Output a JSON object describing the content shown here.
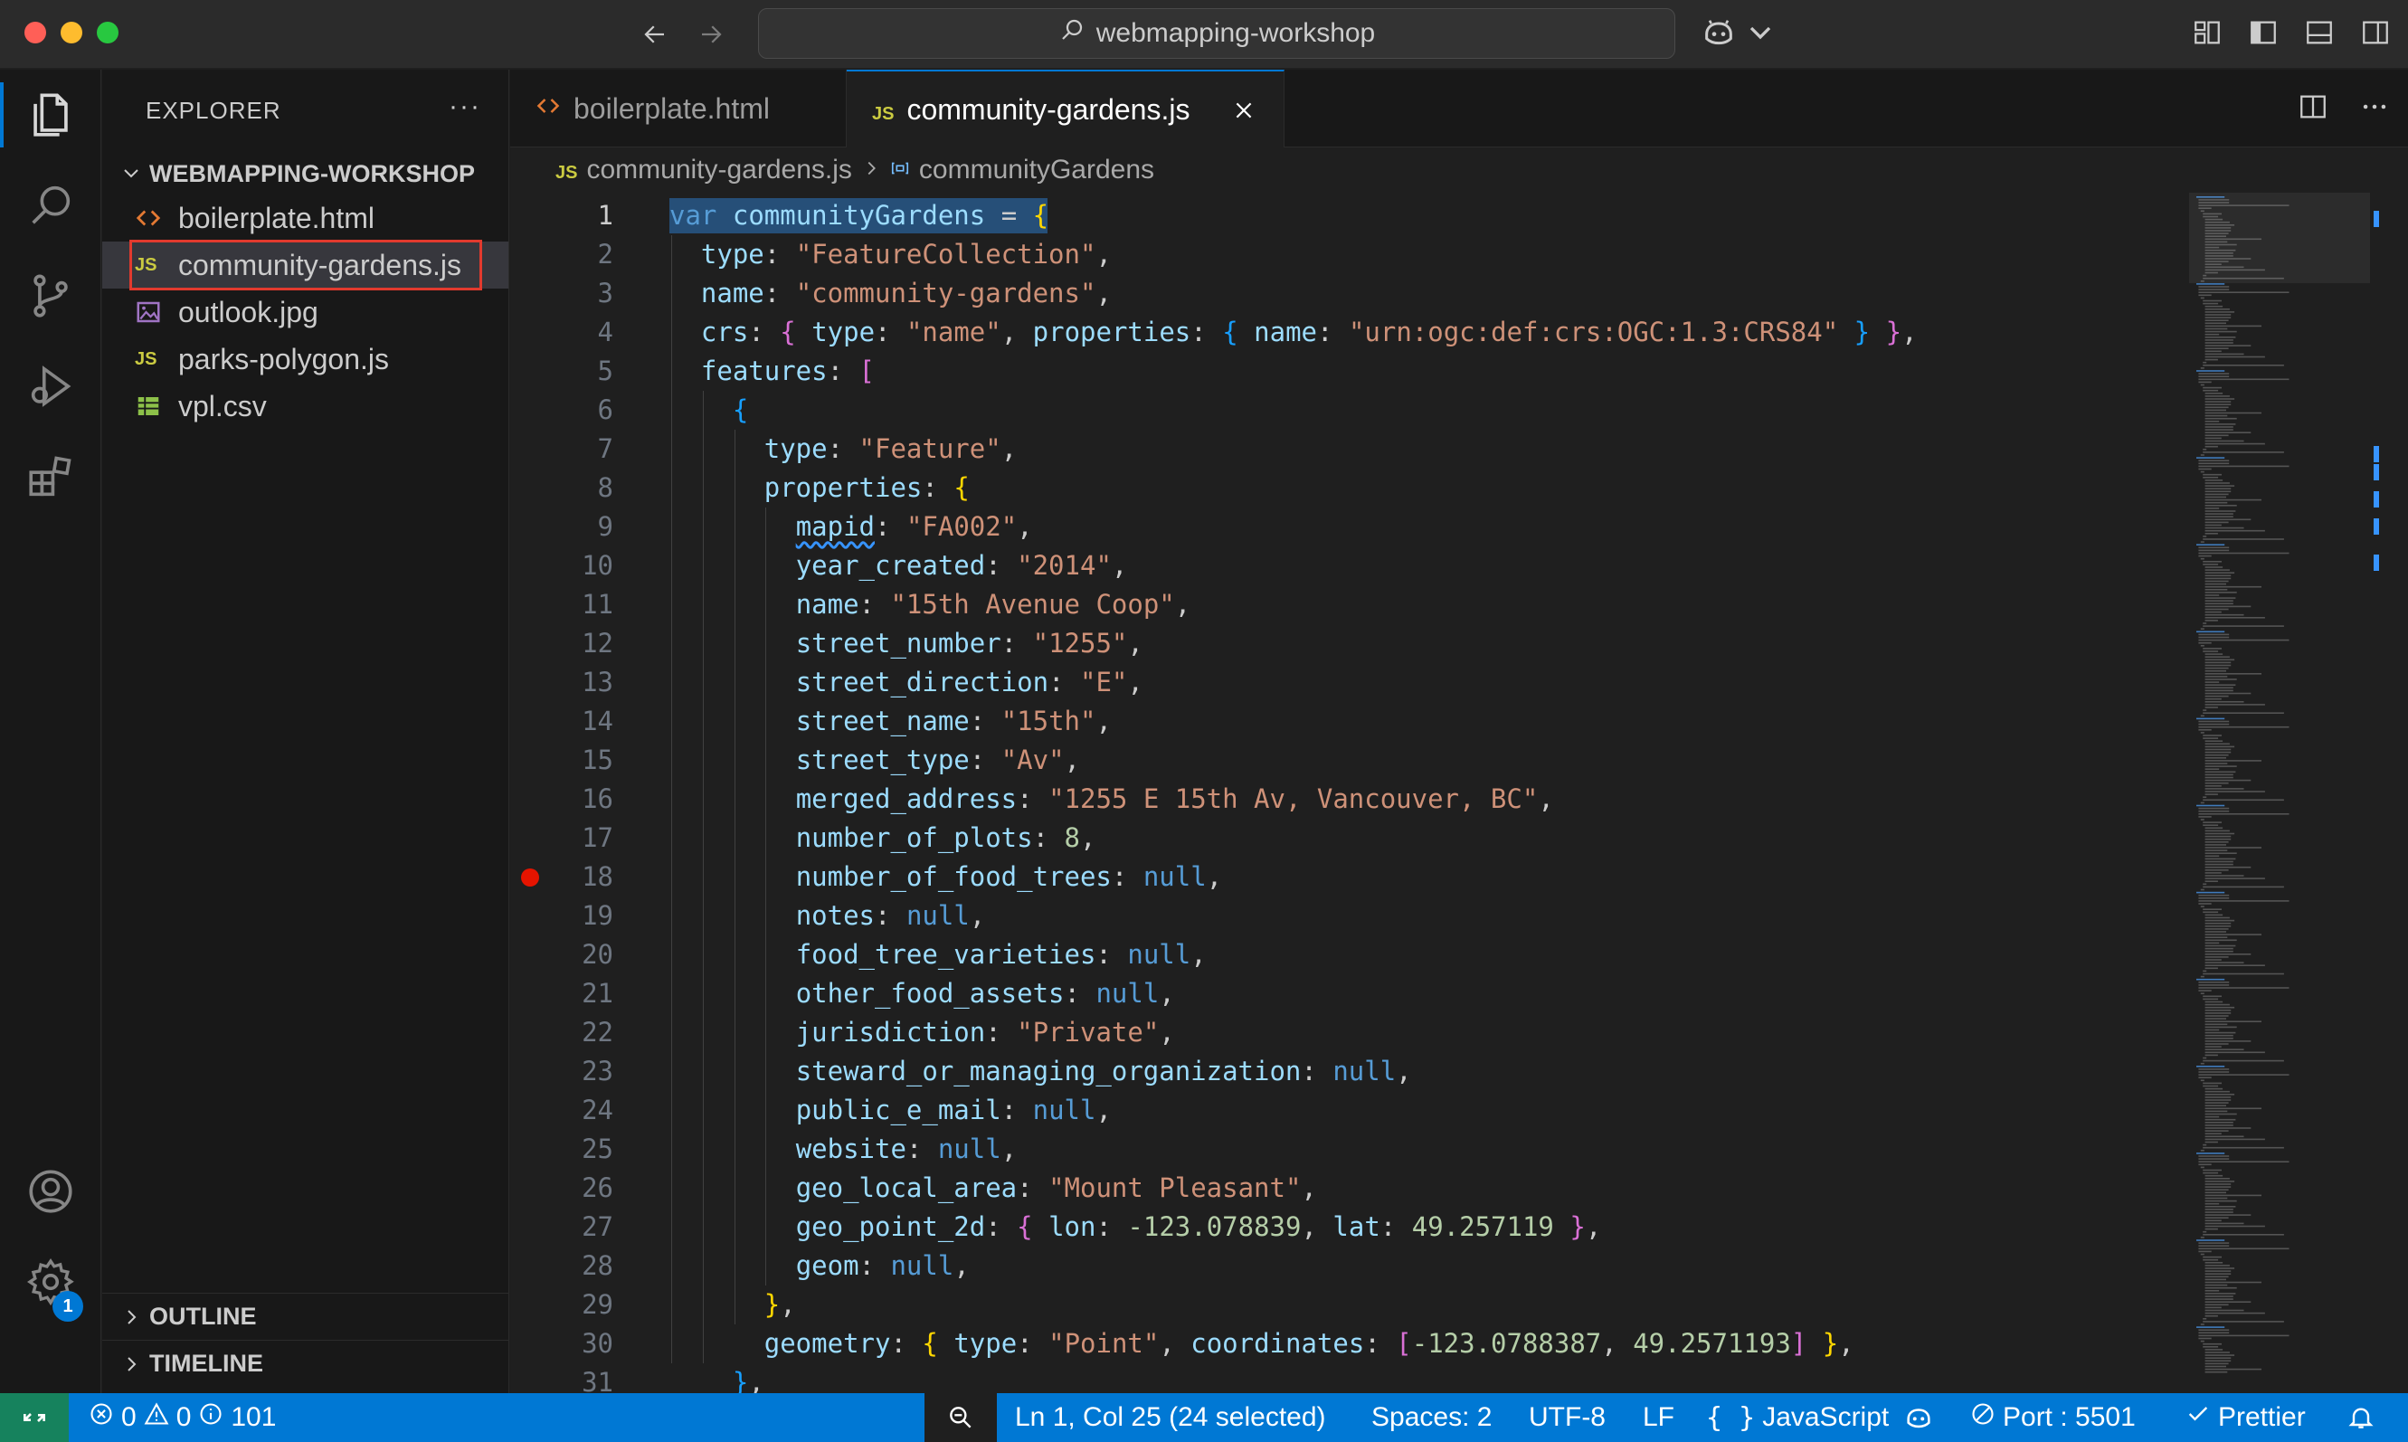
{
  "window": {
    "title": "webmapping-workshop"
  },
  "sidebar": {
    "header": "EXPLORER",
    "more": "···",
    "folder": "WEBMAPPING-WORKSHOP",
    "files": [
      {
        "name": "boilerplate.html",
        "icon": "html-icon"
      },
      {
        "name": "community-gardens.js",
        "icon": "js-icon",
        "selected": true
      },
      {
        "name": "outlook.jpg",
        "icon": "image-icon"
      },
      {
        "name": "parks-polygon.js",
        "icon": "js-icon"
      },
      {
        "name": "vpl.csv",
        "icon": "csv-icon"
      }
    ],
    "js_label": "JS",
    "outline": "OUTLINE",
    "timeline": "TIMELINE"
  },
  "tabs": [
    {
      "label": "boilerplate.html",
      "active": false
    },
    {
      "label": "community-gardens.js",
      "active": true
    }
  ],
  "breadcrumb": {
    "file": "community-gardens.js",
    "symbol": "communityGardens"
  },
  "editor": {
    "breakpoint_line": 18,
    "current_line": 1,
    "lines": [
      "var communityGardens = {",
      "  type: \"FeatureCollection\",",
      "  name: \"community-gardens\",",
      "  crs: { type: \"name\", properties: { name: \"urn:ogc:def:crs:OGC:1.3:CRS84\" } },",
      "  features: [",
      "    {",
      "      type: \"Feature\",",
      "      properties: {",
      "        mapid: \"FA002\",",
      "        year_created: \"2014\",",
      "        name: \"15th Avenue Coop\",",
      "        street_number: \"1255\",",
      "        street_direction: \"E\",",
      "        street_name: \"15th\",",
      "        street_type: \"Av\",",
      "        merged_address: \"1255 E 15th Av, Vancouver, BC\",",
      "        number_of_plots: 8,",
      "        number_of_food_trees: null,",
      "        notes: null,",
      "        food_tree_varieties: null,",
      "        other_food_assets: null,",
      "        jurisdiction: \"Private\",",
      "        steward_or_managing_organization: null,",
      "        public_e_mail: null,",
      "        website: null,",
      "        geo_local_area: \"Mount Pleasant\",",
      "        geo_point_2d: { lon: -123.078839, lat: 49.257119 },",
      "        geom: null,",
      "      },",
      "      geometry: { type: \"Point\", coordinates: [-123.0788387, 49.2571193] },",
      "    },"
    ]
  },
  "statusbar": {
    "errors": "0",
    "warnings": "0",
    "infos": "101",
    "position": "Ln 1, Col 25 (24 selected)",
    "spaces": "Spaces: 2",
    "encoding": "UTF-8",
    "eol": "LF",
    "language": "JavaScript",
    "port": "Port : 5501",
    "prettier": "Prettier"
  },
  "activity": {
    "settings_badge": "1"
  },
  "colors": {
    "accent": "#0078d4",
    "highlight_border": "#e23a2e",
    "breakpoint": "#e51400"
  }
}
